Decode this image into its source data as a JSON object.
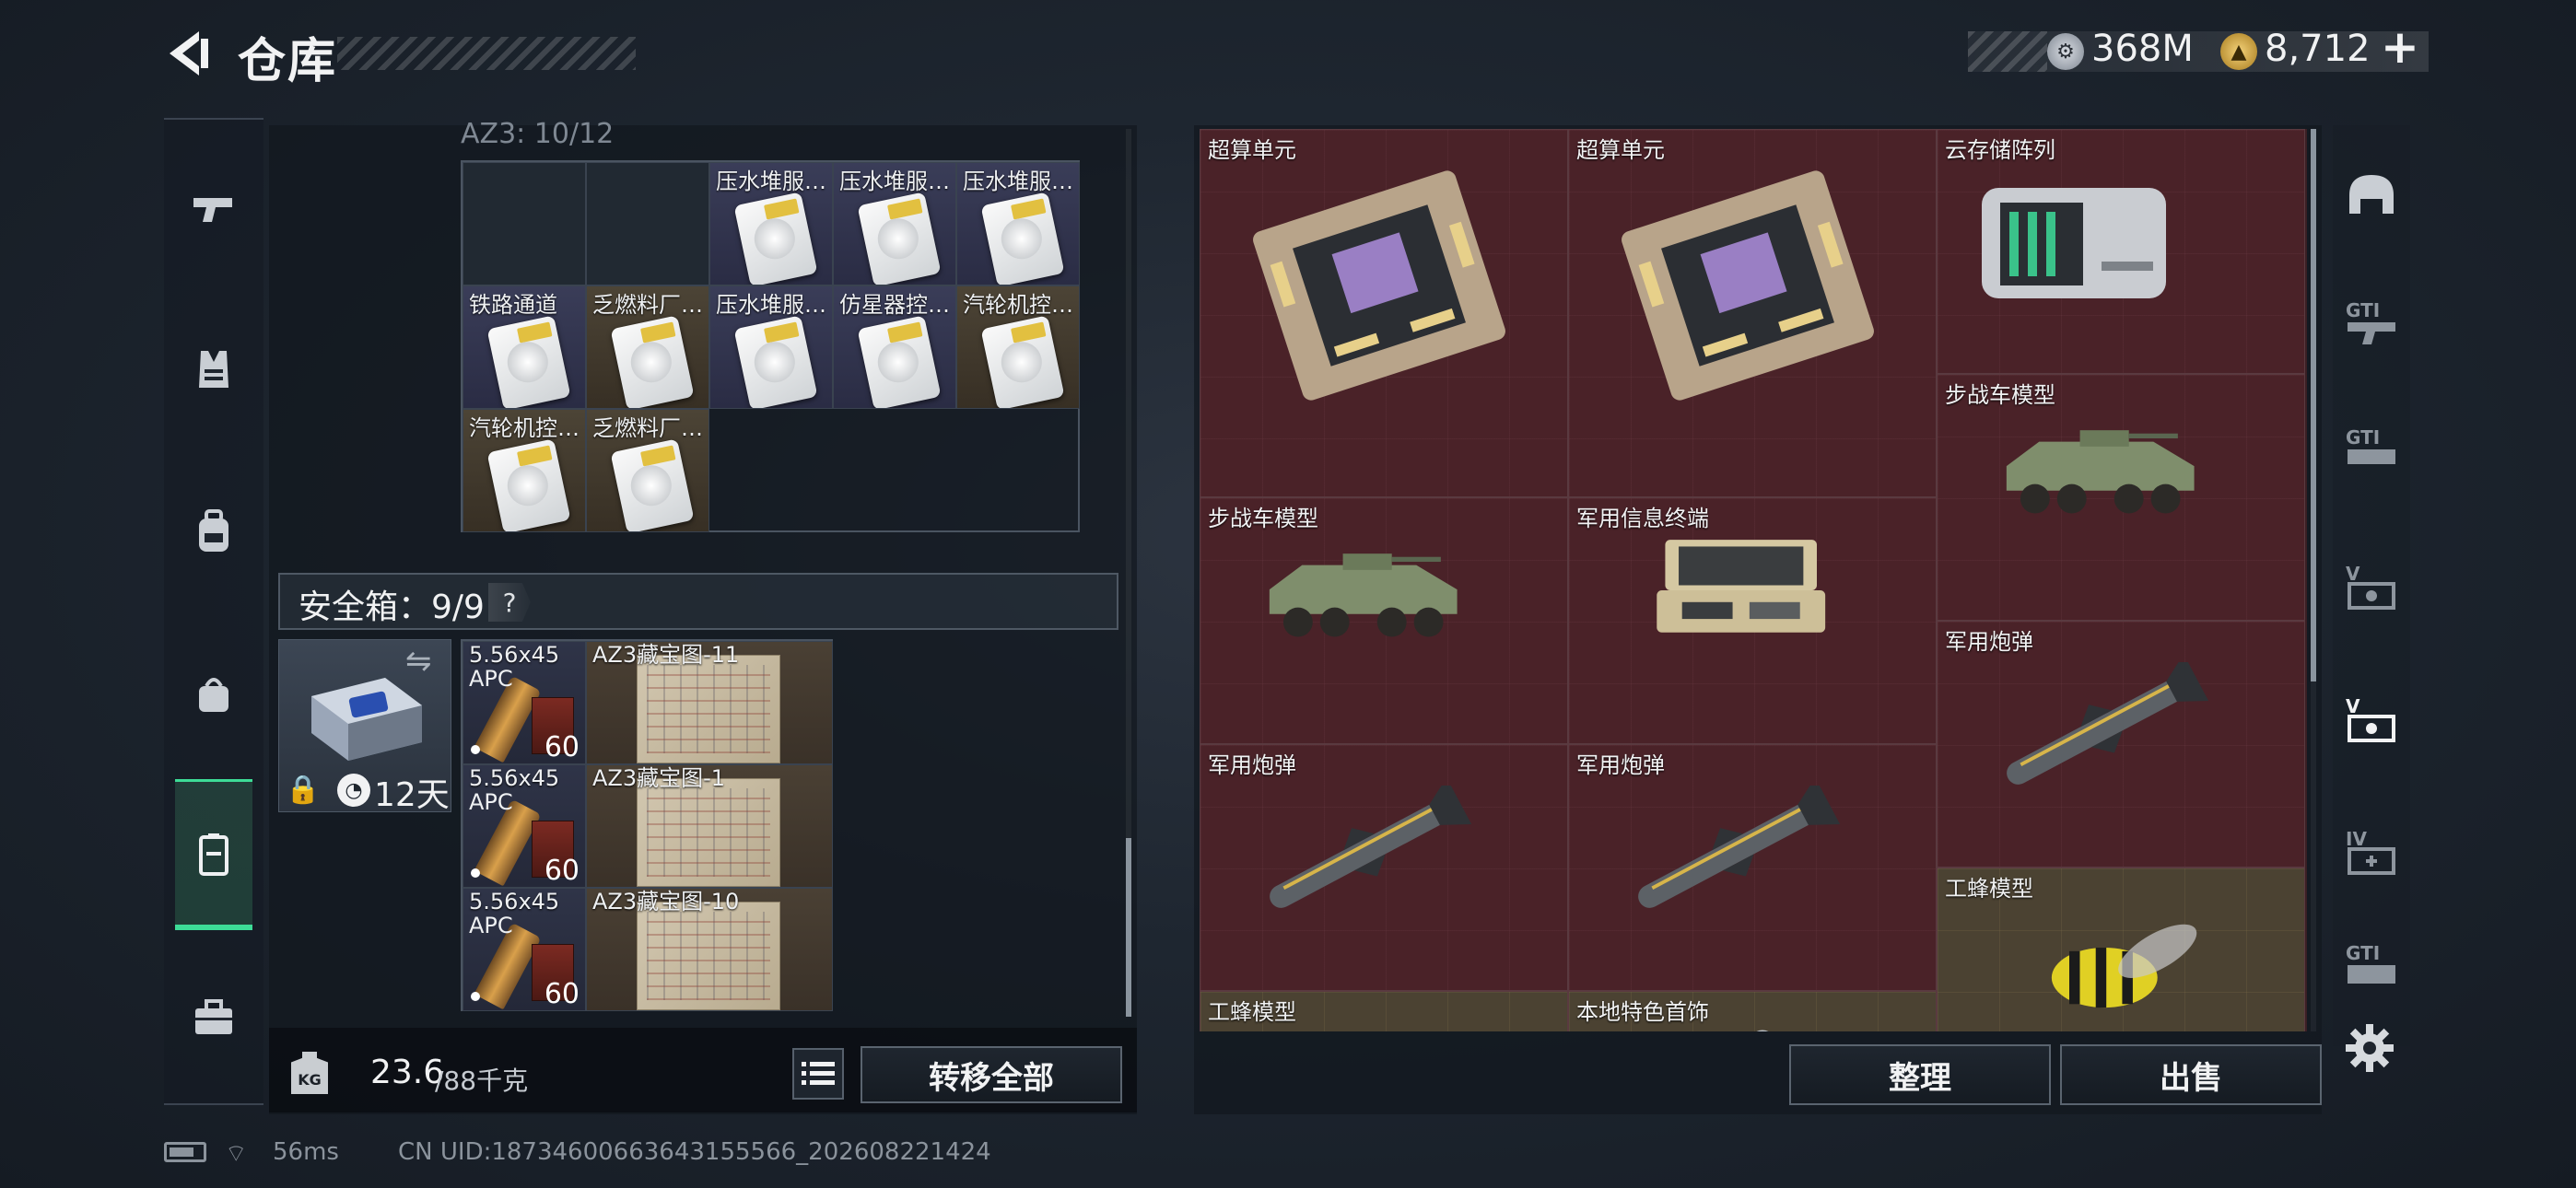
{
  "header": {
    "title": "仓库",
    "currency_silver": "368M",
    "currency_gold": "8,712",
    "plus": "+"
  },
  "storage": {
    "section_label": "AZ3: 10/12",
    "grid": [
      {
        "label": "",
        "kind": "empty"
      },
      {
        "label": "",
        "kind": "empty"
      },
      {
        "label": "压水堆服…",
        "kind": "blue"
      },
      {
        "label": "压水堆服…",
        "kind": "blue"
      },
      {
        "label": "压水堆服…",
        "kind": "blue"
      },
      {
        "label": "铁路通道",
        "kind": "blue"
      },
      {
        "label": "乏燃料厂…",
        "kind": "brown"
      },
      {
        "label": "压水堆服…",
        "kind": "blue"
      },
      {
        "label": "仿星器控…",
        "kind": "blue"
      },
      {
        "label": "汽轮机控…",
        "kind": "brown"
      },
      {
        "label": "汽轮机控…",
        "kind": "brown"
      },
      {
        "label": "乏燃料厂…",
        "kind": "brown"
      }
    ]
  },
  "safebox": {
    "label": "安全箱：9/9",
    "help": "?",
    "expiry": "12天",
    "items": [
      {
        "label": "5.56x45",
        "sub": "APC",
        "count": "60"
      },
      {
        "label": "AZ3藏宝图-11"
      },
      {
        "label": "5.56x45",
        "sub": "APC",
        "count": "60"
      },
      {
        "label": "AZ3藏宝图-1"
      },
      {
        "label": "5.56x45",
        "sub": "APC",
        "count": "60"
      },
      {
        "label": "AZ3藏宝图-10"
      }
    ]
  },
  "weight": {
    "current": "23.6",
    "max": "/88千克",
    "kg_icon": "KG"
  },
  "buttons": {
    "transfer_all": "转移全部",
    "sort": "整理",
    "sell": "出售"
  },
  "loot": [
    {
      "label": "超算单元",
      "icon": "circuit-board-icon"
    },
    {
      "label": "超算单元",
      "icon": "circuit-board-icon"
    },
    {
      "label": "云存储阵列",
      "icon": "server-icon"
    },
    {
      "label": "步战车模型",
      "icon": "apc-icon"
    },
    {
      "label": "步战车模型",
      "icon": "apc-icon"
    },
    {
      "label": "军用信息终端",
      "icon": "terminal-icon"
    },
    {
      "label": "军用炮弹",
      "icon": "missile-icon"
    },
    {
      "label": "军用炮弹",
      "icon": "missile-icon"
    },
    {
      "label": "军用炮弹",
      "icon": "missile-icon"
    },
    {
      "label": "工蜂模型",
      "icon": "wasp-icon"
    },
    {
      "label": "工蜂模型",
      "icon": "wasp-icon"
    },
    {
      "label": "本地特色首饰",
      "icon": "jewelry-icon"
    }
  ],
  "right_nav": [
    "helmet-icon",
    "GTI",
    "GTI",
    "V",
    "V",
    "IV",
    "GTI"
  ],
  "footer": {
    "ping": "56ms",
    "uid": "CN UID:18734600663643155566_202608221424"
  }
}
